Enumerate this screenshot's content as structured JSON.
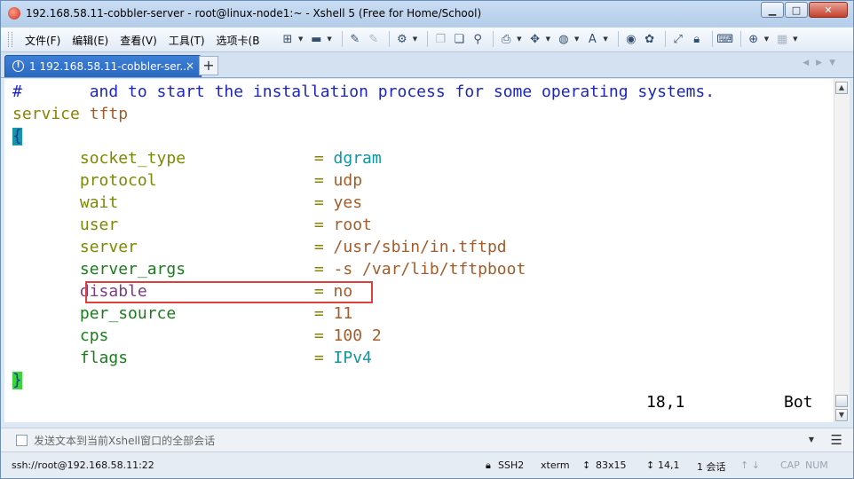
{
  "window": {
    "title": "192.168.58.11-cobbler-server - root@linux-node1:~ - Xshell 5 (Free for Home/School)",
    "minimize": "▁",
    "maximize": "□",
    "close": "✕"
  },
  "menu": [
    "文件(F)",
    "编辑(E)",
    "查看(V)",
    "工具(T)",
    "选项卡(B"
  ],
  "tabs": [
    {
      "index": "1",
      "label": "1 192.168.58.11-cobbler-ser...",
      "close": "×"
    }
  ],
  "tab_add": "+",
  "terminal": {
    "comment_line": {
      "hash": "#",
      "text": "and to start the installation process for some operating systems."
    },
    "service_line": {
      "keyword": "service",
      "name": "tftp"
    },
    "open_brace": "{",
    "settings": [
      {
        "key": "socket_type",
        "value": "dgram"
      },
      {
        "key": "protocol",
        "value": "udp"
      },
      {
        "key": "wait",
        "value": "yes"
      },
      {
        "key": "user",
        "value": "root"
      },
      {
        "key": "server",
        "value": "/usr/sbin/in.tftpd"
      },
      {
        "key": "server_args",
        "value": "-s /var/lib/tftpboot"
      },
      {
        "key": "disable",
        "value": "no"
      },
      {
        "key": "per_source",
        "value": "11"
      },
      {
        "key": "cps",
        "value": "100 2"
      },
      {
        "key": "flags",
        "value": "IPv4"
      }
    ],
    "equals": "=",
    "close_brace": "}",
    "cursor_pos": "18,1",
    "scroll_pos": "Bot"
  },
  "compose": {
    "placeholder": "发送文本到当前Xshell窗口的全部会话"
  },
  "status": {
    "connection": "ssh://root@192.168.58.11:22",
    "protocol": "SSH2",
    "terminal_type": "xterm",
    "size": "83x15",
    "position": "14,1",
    "sessions": "1 会话",
    "caps": "CAP",
    "num": "NUM"
  }
}
